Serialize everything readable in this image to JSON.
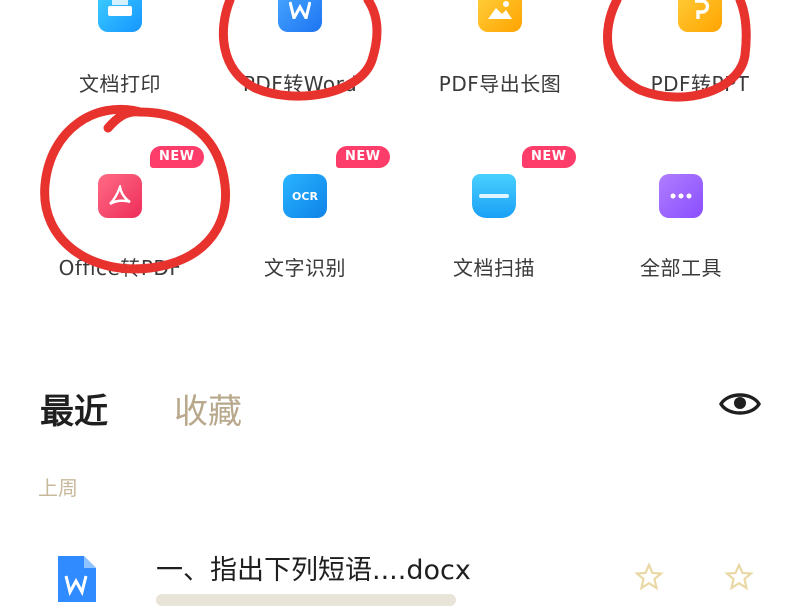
{
  "tools": [
    {
      "id": "print",
      "label": "文档打印",
      "icon": "printer-icon",
      "color": "#2ab0ff",
      "badge": ""
    },
    {
      "id": "pdf-word",
      "label": "PDF转Word",
      "icon": "word-doc-icon",
      "color": "#2f8bff",
      "badge": ""
    },
    {
      "id": "pdf-image",
      "label": "PDF导出长图",
      "icon": "image-icon",
      "color": "#ffb400",
      "badge": ""
    },
    {
      "id": "pdf-ppt",
      "label": "PDF转PPT",
      "icon": "ppt-doc-icon",
      "color": "#ffb300",
      "badge": ""
    },
    {
      "id": "office-pdf",
      "label": "Office转PDF",
      "icon": "pdf-icon",
      "color": "#ff4d6d",
      "badge": "NEW"
    },
    {
      "id": "ocr",
      "label": "文字识别",
      "icon": "ocr-icon",
      "color": "#1e9cf0",
      "badge": "NEW"
    },
    {
      "id": "scan",
      "label": "文档扫描",
      "icon": "scanner-icon",
      "color": "#28b8ff",
      "badge": "NEW"
    },
    {
      "id": "all",
      "label": "全部工具",
      "icon": "more-icon",
      "color": "#9c6bff",
      "badge": ""
    }
  ],
  "tabs": {
    "recent": "最近",
    "favorites": "收藏"
  },
  "section": {
    "last_week": "上周"
  },
  "files": [
    {
      "name": "一、指出下列短语....docx",
      "icon": "word-doc-icon",
      "color": "#2f8bff"
    }
  ],
  "colors": {
    "accent_inactive": "#b8a88c",
    "annotation": "#e8322e",
    "badge": "#ff3d6b"
  }
}
